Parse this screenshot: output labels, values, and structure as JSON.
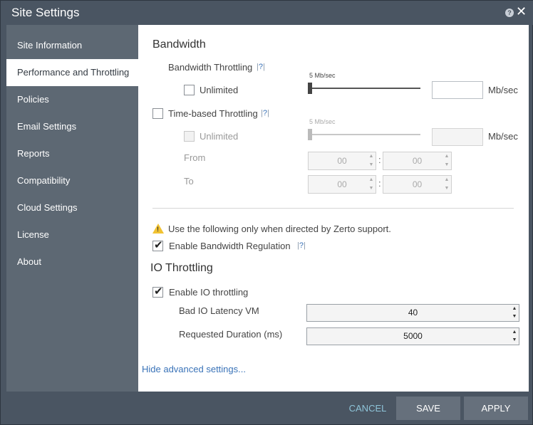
{
  "window": {
    "title": "Site Settings"
  },
  "sidebar": {
    "items": [
      {
        "label": "Site Information",
        "active": false
      },
      {
        "label": "Performance and Throttling",
        "active": true
      },
      {
        "label": "Policies",
        "active": false
      },
      {
        "label": "Email Settings",
        "active": false
      },
      {
        "label": "Reports",
        "active": false
      },
      {
        "label": "Compatibility",
        "active": false
      },
      {
        "label": "Cloud Settings",
        "active": false
      },
      {
        "label": "License",
        "active": false
      },
      {
        "label": "About",
        "active": false
      }
    ]
  },
  "bandwidth": {
    "heading": "Bandwidth",
    "throttling_label": "Bandwidth Throttling",
    "help_label": "?",
    "slider_caption": "5 Mb/sec",
    "unlimited_label": "Unlimited",
    "unlimited_checked": false,
    "unit": "Mb/sec",
    "value": ""
  },
  "time_based": {
    "label": "Time-based Throttling",
    "help_label": "?",
    "checked": false,
    "slider_caption": "5 Mb/sec",
    "unlimited_label": "Unlimited",
    "unit": "Mb/sec",
    "value": "",
    "from_label": "From",
    "to_label": "To",
    "from_hours": "00",
    "from_minutes": "00",
    "to_hours": "00",
    "to_minutes": "00",
    "colon": ":"
  },
  "advanced": {
    "warning_text": "Use the following only when directed by Zerto support.",
    "bandwidth_regulation_label": "Enable Bandwidth Regulation",
    "bandwidth_regulation_checked": true,
    "help_label": "?"
  },
  "io": {
    "heading": "IO Throttling",
    "enable_label": "Enable IO throttling",
    "enable_checked": true,
    "latency_label": "Bad IO Latency VM",
    "latency_value": "40",
    "duration_label": "Requested Duration (ms)",
    "duration_value": "5000"
  },
  "hide_advanced_link": "Hide advanced settings...",
  "footer": {
    "cancel": "CANCEL",
    "save": "SAVE",
    "apply": "APPLY"
  },
  "colors": {
    "accent": "#3a73b8",
    "sidebar": "#5d6873",
    "chrome": "#4a5562",
    "warning": "#f1c232"
  }
}
